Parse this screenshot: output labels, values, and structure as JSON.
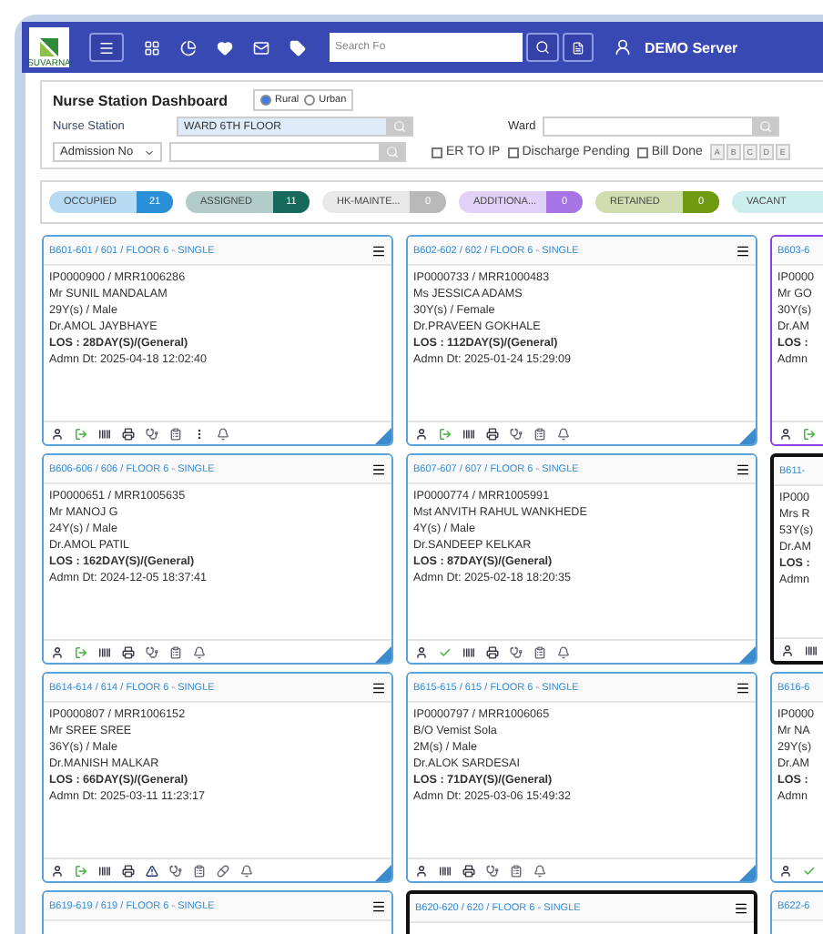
{
  "header": {
    "search": {
      "placeholder": "Search Fo"
    },
    "server": "DEMO Server",
    "logo": "SUVARNA"
  },
  "dashboard": {
    "title": "Nurse Station Dashboard",
    "area": [
      {
        "label": "Rural",
        "selected": true
      },
      {
        "label": "Urban",
        "selected": false
      }
    ]
  },
  "filters": {
    "nurse_station": {
      "label": "Nurse Station",
      "value": "WARD 6TH FLOOR"
    },
    "ward": {
      "label": "Ward"
    },
    "search_by": "Admission No",
    "checks": [
      {
        "label": "ER TO IP",
        "checked": false
      },
      {
        "label": "Discharge Pending",
        "checked": false
      },
      {
        "label": "Bill Done",
        "checked": false
      }
    ],
    "letters": [
      "A",
      "B",
      "C",
      "D",
      "E"
    ]
  },
  "statuses": [
    {
      "label": "OCCUPIED",
      "count": "21",
      "color": "#2b8fd8"
    },
    {
      "label": "ASSIGNED",
      "count": "11",
      "color": "#17695c"
    },
    {
      "label": "HK-MAINTE...",
      "count": "0",
      "color": "#b9b9b9"
    },
    {
      "label": "ADDITIONA...",
      "count": "0",
      "color": "#a774e6"
    },
    {
      "label": "RETAINED",
      "count": "0",
      "color": "#6f9a12"
    },
    {
      "label": "VACANT",
      "color": "#cdeeed"
    }
  ],
  "beds": [
    {
      "title": "B601-601 / 601 / FLOOR 6 - SINGLE",
      "color": "#5aa2dc",
      "ip": "IP0000900 / MRR1006286",
      "name": "Mr SUNIL MANDALAM",
      "age": "29Y(s) / Male",
      "doctor": "Dr.AMOL JAYBHAYE",
      "los": "LOS : 28DAY(S)/(General)",
      "admitted": "Admn Dt: 2025-04-18 12:02:40",
      "icons": [
        {
          "kind": "person"
        },
        {
          "kind": "exit"
        },
        {
          "kind": "barcode"
        },
        {
          "kind": "print"
        },
        {
          "kind": "stethoscope"
        },
        {
          "kind": "clipboard"
        },
        {
          "kind": "more"
        },
        {
          "kind": "bell"
        }
      ]
    },
    {
      "title": "B602-602 / 602 / FLOOR 6 - SINGLE",
      "color": "#5aa2dc",
      "ip": "IP0000733 / MRR1000483",
      "name": "Ms JESSICA ADAMS",
      "age": "30Y(s) / Female",
      "doctor": "Dr.PRAVEEN GOKHALE",
      "los": "LOS : 112DAY(S)/(General)",
      "admitted": "Admn Dt: 2025-01-24 15:29:09",
      "icons": [
        {
          "kind": "person"
        },
        {
          "kind": "exit"
        },
        {
          "kind": "barcode"
        },
        {
          "kind": "print"
        },
        {
          "kind": "stethoscope"
        },
        {
          "kind": "clipboard"
        },
        {
          "kind": "bell"
        }
      ]
    },
    {
      "title": "B603-6",
      "color": "#8a3ff0",
      "ip": "IP0000",
      "name": "Mr GO",
      "age": "30Y(s)",
      "doctor": "Dr.AM",
      "los": "LOS :",
      "admitted": "Admn",
      "icons": [
        {
          "kind": "person"
        },
        {
          "kind": "exit"
        }
      ]
    },
    {
      "title": "B606-606 / 606 / FLOOR 6 - SINGLE",
      "color": "#5aa2dc",
      "ip": "IP0000651 / MRR1005635",
      "name": "Mr MANOJ G",
      "age": "24Y(s) / Male",
      "doctor": "Dr.AMOL PATIL",
      "los": "LOS : 162DAY(S)/(General)",
      "admitted": "Admn Dt: 2024-12-05 18:37:41",
      "icons": [
        {
          "kind": "person"
        },
        {
          "kind": "exit"
        },
        {
          "kind": "barcode"
        },
        {
          "kind": "print"
        },
        {
          "kind": "stethoscope"
        },
        {
          "kind": "clipboard"
        },
        {
          "kind": "bell"
        }
      ]
    },
    {
      "title": "B607-607 / 607 / FLOOR 6 - SINGLE",
      "color": "#5aa2dc",
      "ip": "IP0000774 / MRR1005991",
      "name": "Mst ANVITH RAHUL WANKHEDE",
      "age": "4Y(s) / Male",
      "doctor": "Dr.SANDEEP KELKAR",
      "los": "LOS : 87DAY(S)/(General)",
      "admitted": "Admn Dt: 2025-02-18 18:20:35",
      "icons": [
        {
          "kind": "person"
        },
        {
          "kind": "check"
        },
        {
          "kind": "barcode"
        },
        {
          "kind": "print"
        },
        {
          "kind": "stethoscope"
        },
        {
          "kind": "clipboard"
        },
        {
          "kind": "bell"
        }
      ]
    },
    {
      "title": "B611-",
      "color": "#111111",
      "ip": "IP000",
      "name": "Mrs R",
      "age": "53Y(s)",
      "doctor": "Dr.AM",
      "los": "LOS :",
      "admitted": "Admn",
      "icons": [
        {
          "kind": "person"
        },
        {
          "kind": "barcode"
        }
      ]
    },
    {
      "title": "B614-614 / 614 / FLOOR 6 - SINGLE",
      "color": "#5aa2dc",
      "ip": "IP0000807 / MRR1006152",
      "name": "Mr SREE SREE",
      "age": "36Y(s) / Male",
      "doctor": "Dr.MANISH MALKAR",
      "los": "LOS : 66DAY(S)/(General)",
      "admitted": "Admn Dt: 2025-03-11 11:23:17",
      "icons": [
        {
          "kind": "person"
        },
        {
          "kind": "exit"
        },
        {
          "kind": "barcode"
        },
        {
          "kind": "print"
        },
        {
          "kind": "warning"
        },
        {
          "kind": "stethoscope"
        },
        {
          "kind": "clipboard"
        },
        {
          "kind": "pill"
        },
        {
          "kind": "bell"
        }
      ]
    },
    {
      "title": "B615-615 / 615 / FLOOR 6 - SINGLE",
      "color": "#5aa2dc",
      "ip": "IP0000797 / MRR1006065",
      "name": "B/O Vemist Sola",
      "age": "2M(s) / Male",
      "doctor": "Dr.ALOK SARDESAI",
      "los": "LOS : 71DAY(S)/(General)",
      "admitted": "Admn Dt: 2025-03-06 15:49:32",
      "icons": [
        {
          "kind": "person"
        },
        {
          "kind": "barcode"
        },
        {
          "kind": "print"
        },
        {
          "kind": "stethoscope"
        },
        {
          "kind": "clipboard"
        },
        {
          "kind": "bell"
        }
      ]
    },
    {
      "title": "B616-6",
      "color": "#5aa2dc",
      "ip": "IP0000",
      "name": "Mr NA",
      "age": "29Y(s)",
      "doctor": "Dr.AM",
      "los": "LOS :",
      "admitted": "Admn",
      "icons": [
        {
          "kind": "person"
        },
        {
          "kind": "check"
        }
      ]
    },
    {
      "title": "B619-619 / 619 / FLOOR 6 - SINGLE",
      "color": "#5aa2dc"
    },
    {
      "title": "B620-620 / 620 / FLOOR 6 - SINGLE",
      "color": "#111111"
    },
    {
      "title": "B622-6",
      "color": "#5aa2dc"
    }
  ]
}
